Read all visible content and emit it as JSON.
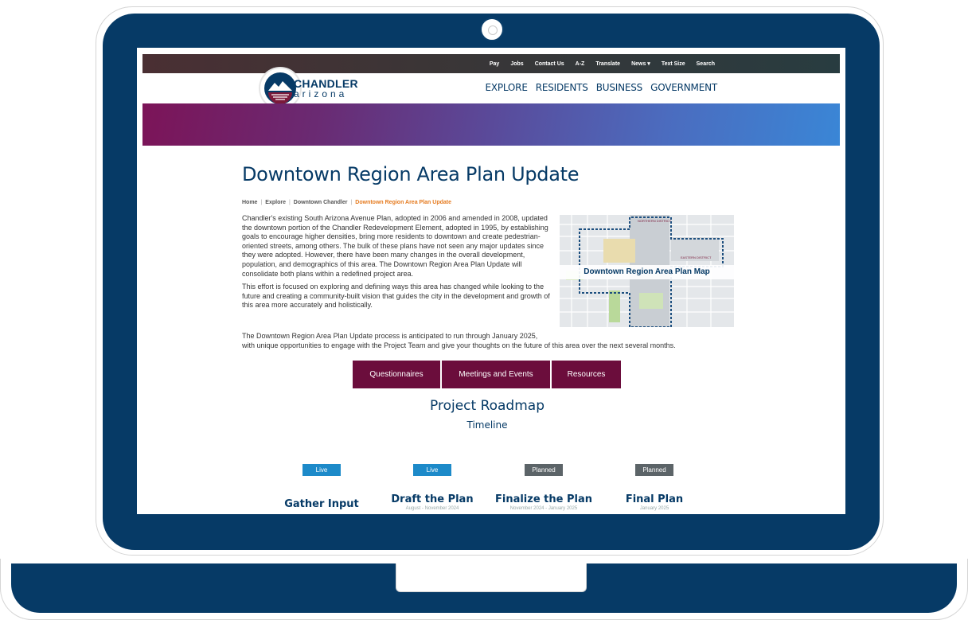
{
  "utility_nav": [
    "Pay",
    "Jobs",
    "Contact Us",
    "A-Z",
    "Translate",
    "News ▾",
    "Text Size",
    "Search"
  ],
  "logo": {
    "line1": "CHANDLER",
    "line2": "arizona"
  },
  "main_nav": [
    "EXPLORE",
    "RESIDENTS",
    "BUSINESS",
    "GOVERNMENT"
  ],
  "page_title": "Downtown Region Area Plan Update",
  "breadcrumb": {
    "items": [
      "Home",
      "Explore",
      "Downtown Chandler"
    ],
    "current": "Downtown Region Area Plan Update",
    "separator": "|"
  },
  "intro": {
    "p1": "Chandler's existing South Arizona Avenue Plan, adopted in 2006 and amended in 2008, updated the downtown portion of the Chandler Redevelopment Element, adopted in 1995, by establishing goals to encourage higher densities, bring more residents to downtown and create pedestrian-oriented streets, among others. The bulk of these plans have not seen any major updates since they were adopted. However, there have been many changes in the overall development, population, and demographics of this area. The Downtown Region Area Plan Update will consolidate both plans within a redefined project area.",
    "p2": "This effort is focused on exploring and defining ways this area has changed while looking to the future and creating a community-built vision that guides the city in the development and growth of this area more accurately and holistically.",
    "p3a": "The Downtown Region Area Plan Update process is anticipated to run through January 2025,",
    "p3b": "with unique opportunities to engage with the Project Team and give your thoughts on the future of this area over the next several months."
  },
  "map": {
    "caption": "Downtown Region Area Plan Map",
    "label_north": "NORTHERN DISTRICT",
    "label_east": "EASTERN DISTRICT"
  },
  "buttons": [
    "Questionnaires",
    "Meetings and Events",
    "Resources"
  ],
  "roadmap": {
    "title": "Project Roadmap",
    "subtitle": "Timeline",
    "phases": [
      {
        "status": "Live",
        "name": "Gather Input",
        "dates": ""
      },
      {
        "status": "Live",
        "name": "Draft the Plan",
        "dates": "August - November 2024"
      },
      {
        "status": "Planned",
        "name": "Finalize the Plan",
        "dates": "November 2024 - January 2025"
      },
      {
        "status": "Planned",
        "name": "Final Plan",
        "dates": "January 2025"
      }
    ]
  },
  "colors": {
    "laptop_frame": "#063a66",
    "brand_blue": "#063a66",
    "button_maroon": "#6b0d3c",
    "breadcrumb_current": "#e57b20",
    "badge_live": "#1d8ac9",
    "badge_planned": "#5c6468"
  },
  "icons": [
    "camera-icon",
    "logo-icon"
  ]
}
